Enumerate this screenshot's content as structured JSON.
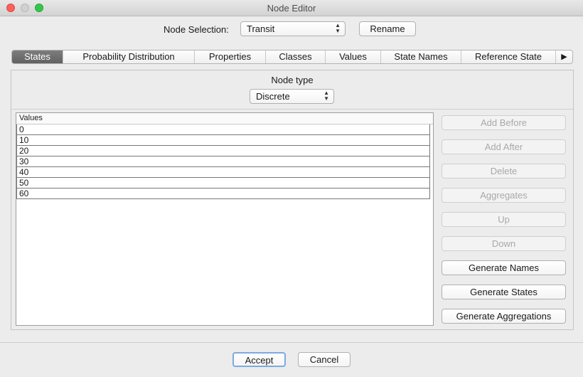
{
  "window": {
    "title": "Node Editor"
  },
  "node_selection": {
    "label": "Node Selection:",
    "value": "Transit",
    "rename_label": "Rename"
  },
  "tabs": [
    {
      "label": "States",
      "active": true
    },
    {
      "label": "Probability Distribution"
    },
    {
      "label": "Properties"
    },
    {
      "label": "Classes"
    },
    {
      "label": "Values"
    },
    {
      "label": "State Names"
    },
    {
      "label": "Reference State"
    }
  ],
  "tab_overflow_icon": "right-triangle-icon",
  "states_panel": {
    "node_type_label": "Node type",
    "node_type_value": "Discrete",
    "values_header": "Values",
    "values": [
      "0",
      "10",
      "20",
      "30",
      "40",
      "50",
      "60"
    ],
    "buttons": {
      "add_before": "Add Before",
      "add_after": "Add After",
      "delete": "Delete",
      "aggregates": "Aggregates",
      "up": "Up",
      "down": "Down",
      "generate_names": "Generate Names",
      "generate_states": "Generate States",
      "generate_aggregations": "Generate Aggregations"
    }
  },
  "footer": {
    "accept_label": "Accept",
    "cancel_label": "Cancel"
  }
}
